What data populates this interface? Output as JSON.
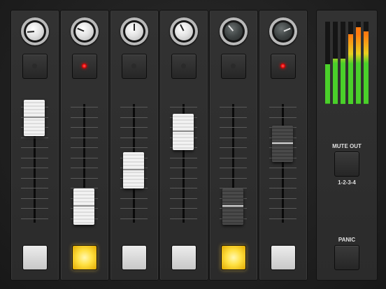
{
  "channels": [
    {
      "knob": 0.15,
      "knob_style": "light",
      "led": false,
      "fader": 1.0,
      "fader_style": "light",
      "bottom_on": false
    },
    {
      "knob": 0.25,
      "knob_style": "light",
      "led": true,
      "fader": 0.12,
      "fader_style": "light",
      "bottom_on": true
    },
    {
      "knob": 0.5,
      "knob_style": "light",
      "led": false,
      "fader": 0.48,
      "fader_style": "light",
      "bottom_on": false
    },
    {
      "knob": 0.4,
      "knob_style": "light",
      "led": false,
      "fader": 0.86,
      "fader_style": "light",
      "bottom_on": false
    },
    {
      "knob": 0.35,
      "knob_style": "dark",
      "led": false,
      "fader": 0.12,
      "fader_style": "dark",
      "bottom_on": true
    },
    {
      "knob": 0.75,
      "knob_style": "dark",
      "led": true,
      "fader": 0.74,
      "fader_style": "dark",
      "bottom_on": false
    }
  ],
  "meters": [
    0.48,
    0.55,
    0.55,
    0.85,
    0.93,
    0.88
  ],
  "mute_out": {
    "label": "MUTE OUT",
    "sublabel": "1-2-3-4"
  },
  "panic": {
    "label": "PANIC"
  },
  "colors": {
    "led_red": "#ff2020",
    "active_yellow": "#ffe040",
    "meter_green": "#4ad02a",
    "meter_yellow": "#e8d020",
    "meter_orange": "#ff7a10"
  }
}
